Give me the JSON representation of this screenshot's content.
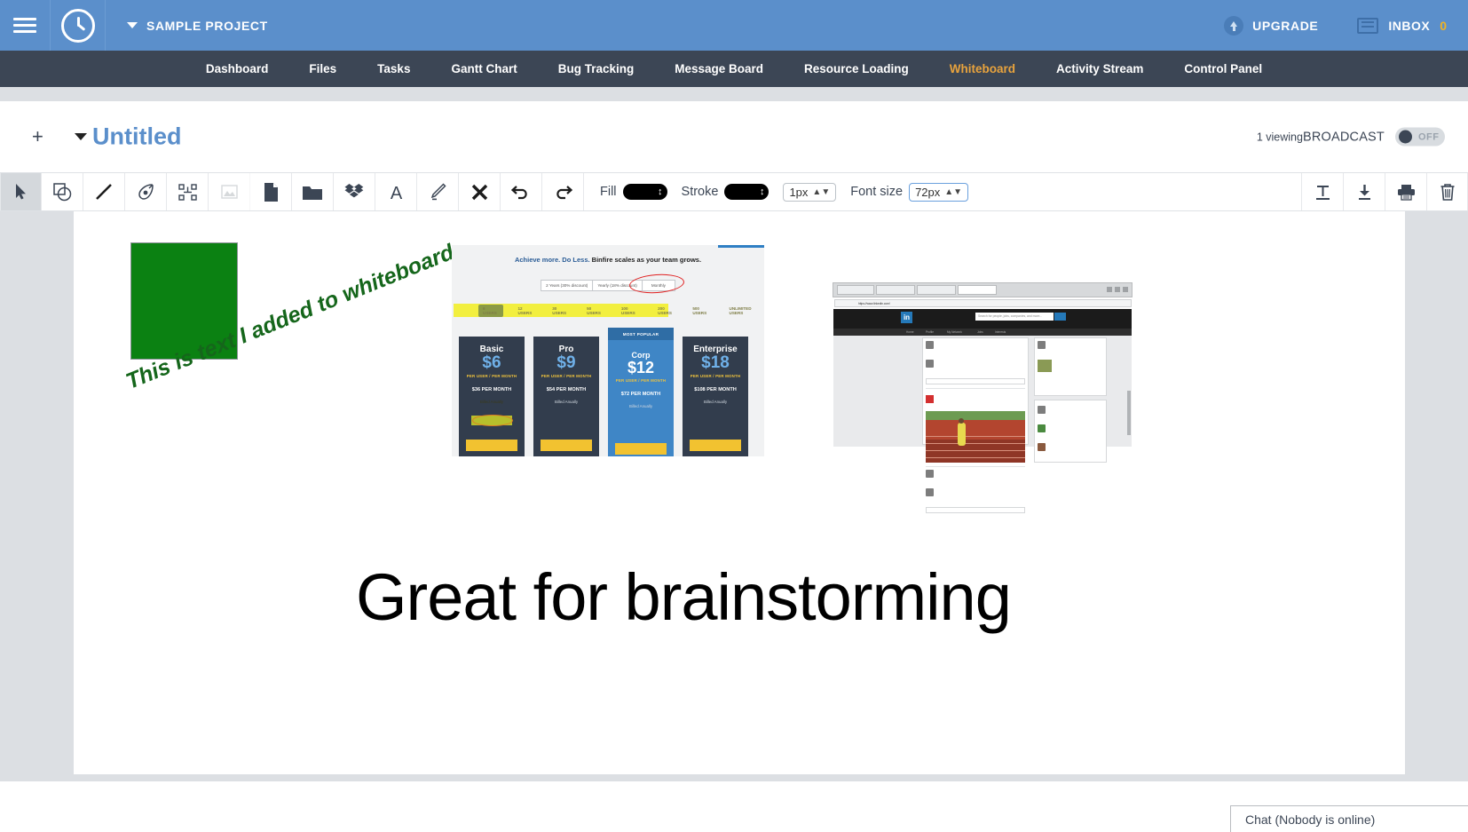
{
  "header": {
    "menu_icon": "hamburger-icon",
    "clock_icon": "clock-icon",
    "project_name": "SAMPLE PROJECT",
    "project_caret_icon": "chevron-down-icon",
    "upgrade_label": "UPGRADE",
    "upgrade_icon": "arrow-up-circle-icon",
    "inbox_label": "INBOX",
    "inbox_icon": "inbox-tray-icon",
    "inbox_count": "0",
    "bg_color": "#5b8fcb",
    "accent_count_color": "#f0b323"
  },
  "nav": {
    "active": "Whiteboard",
    "active_color": "#e8a33d",
    "bg_color": "#3c4655",
    "items": [
      {
        "label": "Dashboard"
      },
      {
        "label": "Files"
      },
      {
        "label": "Tasks"
      },
      {
        "label": "Gantt Chart"
      },
      {
        "label": "Bug Tracking"
      },
      {
        "label": "Message Board"
      },
      {
        "label": "Resource Loading"
      },
      {
        "label": "Whiteboard"
      },
      {
        "label": "Activity Stream"
      },
      {
        "label": "Control Panel"
      }
    ]
  },
  "title_row": {
    "add_label": "+",
    "caret_icon": "caret-down-icon",
    "title": "Untitled",
    "title_color": "#5b8fcb",
    "viewing_text": "1 viewing",
    "broadcast_label": "BROADCAST",
    "broadcast_state": "OFF"
  },
  "toolbar": {
    "tools": [
      {
        "name": "select-tool",
        "icon": "cursor-arrow-icon",
        "active": true,
        "disabled": false
      },
      {
        "name": "shapes-tool",
        "icon": "shapes-icon",
        "active": false,
        "disabled": false
      },
      {
        "name": "line-tool",
        "icon": "line-icon",
        "active": false,
        "disabled": false
      },
      {
        "name": "pen-tool",
        "icon": "pen-nib-icon",
        "active": false,
        "disabled": false
      },
      {
        "name": "transform-tool",
        "icon": "bounding-box-icon",
        "active": false,
        "disabled": false
      },
      {
        "name": "image-tool",
        "icon": "image-icon",
        "active": false,
        "disabled": true
      },
      {
        "name": "file-tool",
        "icon": "file-icon",
        "active": false,
        "disabled": false
      },
      {
        "name": "folder-tool",
        "icon": "folder-icon",
        "active": false,
        "disabled": false
      },
      {
        "name": "dropbox-tool",
        "icon": "dropbox-icon",
        "active": false,
        "disabled": false
      },
      {
        "name": "text-tool",
        "icon": "letter-a-icon",
        "active": false,
        "disabled": false
      },
      {
        "name": "highlighter-tool",
        "icon": "highlighter-pen-icon",
        "active": false,
        "disabled": false
      },
      {
        "name": "delete-tool",
        "icon": "x-close-icon",
        "active": false,
        "disabled": false
      },
      {
        "name": "undo-tool",
        "icon": "undo-arrow-icon",
        "active": false,
        "disabled": false
      },
      {
        "name": "redo-tool",
        "icon": "redo-arrow-icon",
        "active": false,
        "disabled": false
      }
    ],
    "fill_label": "Fill",
    "fill_color": "#000000",
    "stroke_label": "Stroke",
    "stroke_color": "#000000",
    "stroke_width": "1px",
    "font_size_label": "Font size",
    "font_size_value": "72px",
    "right_tools": [
      {
        "name": "text-format-tool",
        "icon": "text-underline-icon"
      },
      {
        "name": "download-button",
        "icon": "download-arrow-icon"
      },
      {
        "name": "print-button",
        "icon": "printer-icon"
      },
      {
        "name": "trash-button",
        "icon": "trash-can-icon"
      }
    ]
  },
  "canvas": {
    "green_square": {
      "fill": "#0b8112",
      "border": "#8c9298"
    },
    "rotated_text": "This is text I added to whiteboard",
    "rotated_text_color": "#15661b",
    "big_text": "Great for brainstorming",
    "big_text_color": "#000000",
    "pricing_shot": {
      "headline_blue": "Achieve more. Do Less.",
      "headline_dark": " Binfire scales as your team grows.",
      "billing_options": [
        "2 Years (30% discount)",
        "Yearly (18% discount)",
        "Monthly"
      ],
      "user_tiers": [
        "6 USERS",
        "12 USERS",
        "30 USERS",
        "50 USERS",
        "100 USERS",
        "200 USERS",
        "500 USERS",
        "UNLIMITED USERS"
      ],
      "most_popular_badge": "MOST POPULAR",
      "plans": [
        {
          "name": "Basic",
          "price": "$6",
          "per": "PER USER / PER MONTH",
          "monthly": "$36 PER MONTH",
          "annual": "Billed Anually",
          "cta": "BUY NOW"
        },
        {
          "name": "Pro",
          "price": "$9",
          "per": "PER USER / PER MONTH",
          "monthly": "$54 PER MONTH",
          "annual": "Billed Anually",
          "cta": "BUY NOW"
        },
        {
          "name": "Corp",
          "price": "$12",
          "per": "PER USER / PER MONTH",
          "monthly": "$72 PER MONTH",
          "annual": "Billed Anually",
          "cta": "BUY NOW"
        },
        {
          "name": "Enterprise",
          "price": "$18",
          "per": "PER USER / PER MONTH",
          "monthly": "$108 PER MONTH",
          "annual": "Billed Anually",
          "cta": "BUY NOW"
        }
      ]
    },
    "linkedin_shot": {
      "url": "https://www.linkedin.com/",
      "search_placeholder": "Search for people, jobs, companies, and more...",
      "logo_text": "in"
    }
  },
  "chat": {
    "label": "Chat (Nobody is online)"
  }
}
